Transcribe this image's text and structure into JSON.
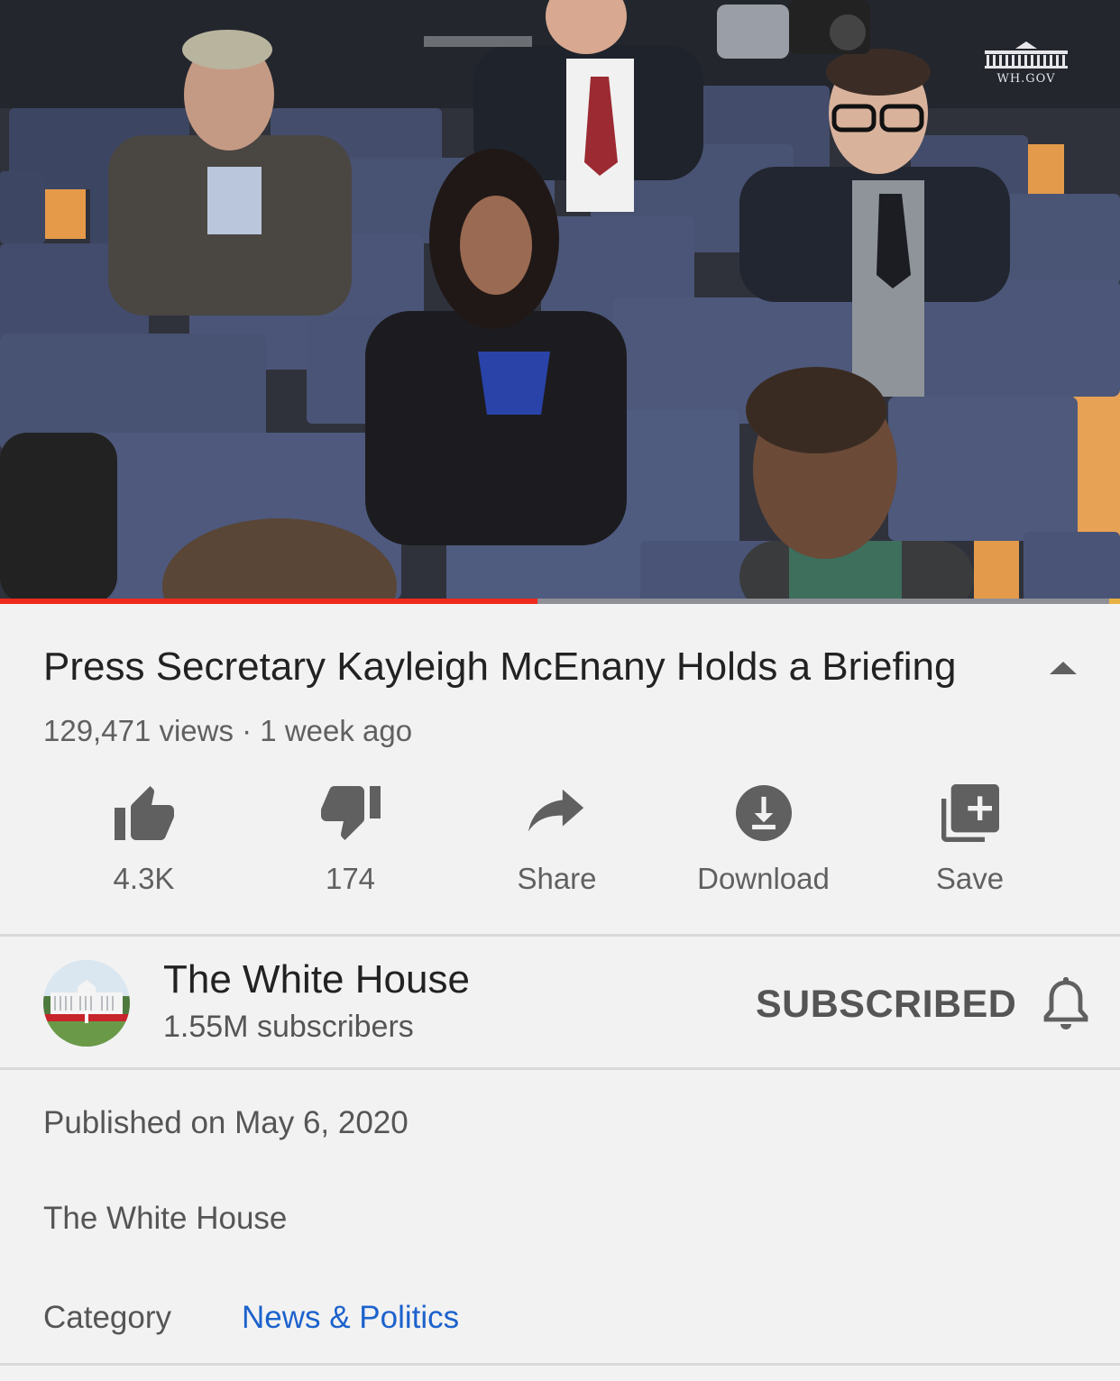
{
  "video": {
    "watermark": "WH.GOV",
    "progress_fraction": 0.48,
    "colors": {
      "progress": "#ee2b1d",
      "track": "#8f9095"
    }
  },
  "title": "Press Secretary Kayleigh McEnany Holds a Briefing",
  "meta": "129,471 views · 1 week ago",
  "actions": [
    {
      "icon": "thumbs-up-icon",
      "label": "4.3K"
    },
    {
      "icon": "thumbs-down-icon",
      "label": "174"
    },
    {
      "icon": "share-icon",
      "label": "Share"
    },
    {
      "icon": "download-icon",
      "label": "Download"
    },
    {
      "icon": "playlist-add-icon",
      "label": "Save"
    }
  ],
  "channel": {
    "name": "The White House",
    "subscribers": "1.55M subscribers",
    "subscribe_state": "SUBSCRIBED"
  },
  "description": {
    "published": "Published on May 6, 2020",
    "text": "The White House",
    "category_label": "Category",
    "category_value": "News & Politics",
    "link_color": "#1c62cc"
  }
}
